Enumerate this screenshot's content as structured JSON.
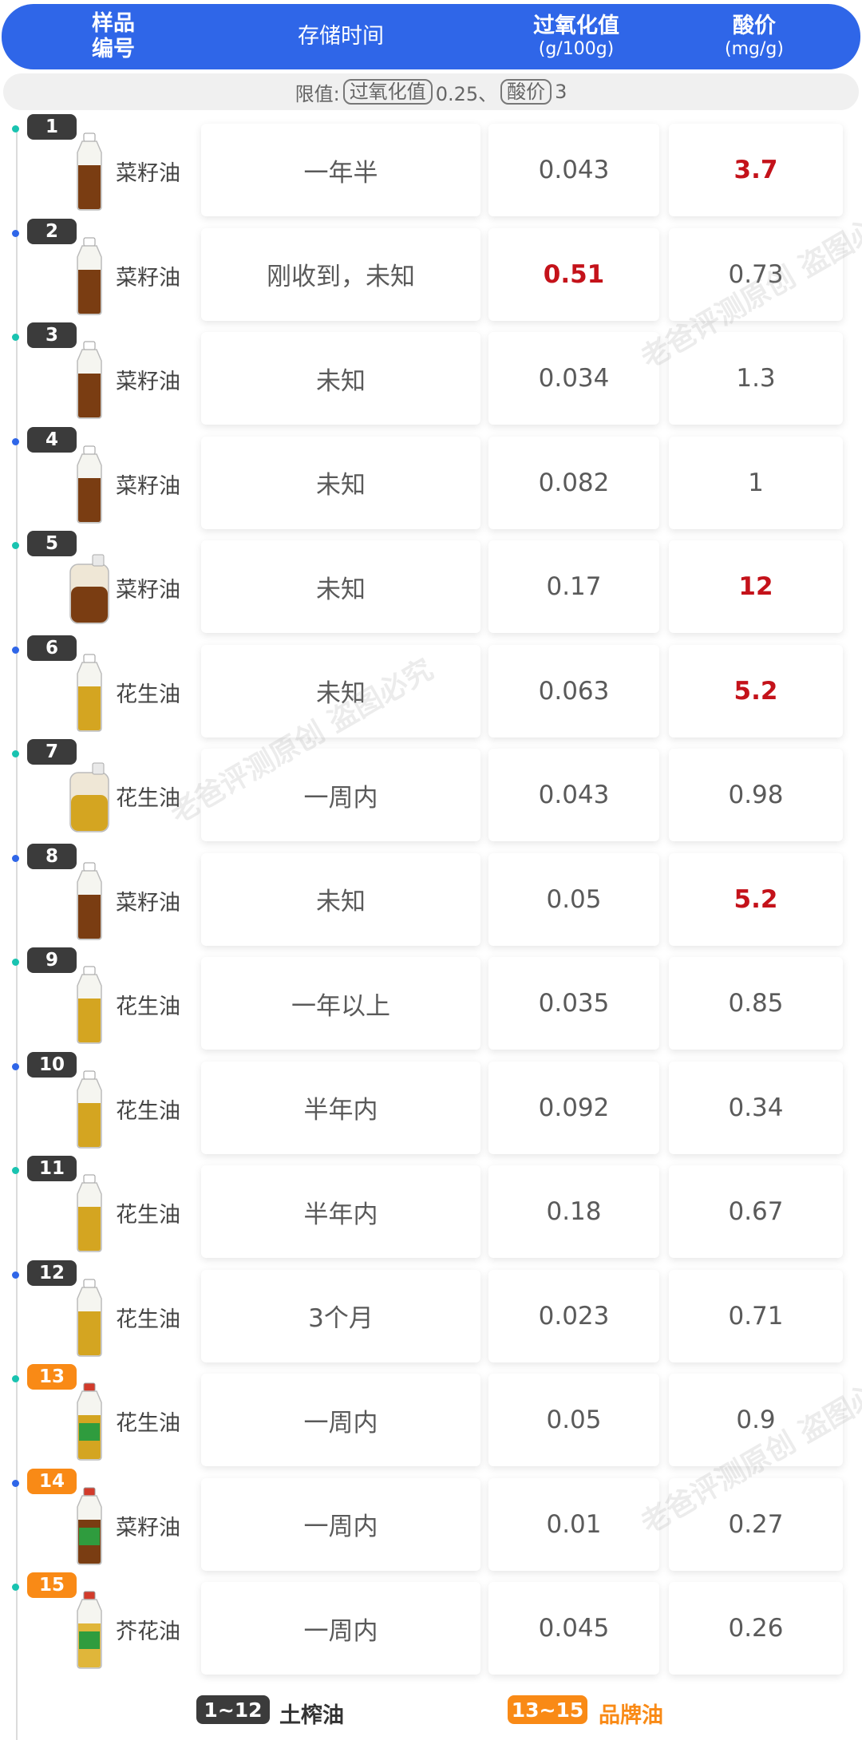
{
  "header": {
    "col_sample_line1": "样品",
    "col_sample_line2": "编号",
    "col_storage": "存储时间",
    "col_peroxide": "过氧化值",
    "col_peroxide_unit": "(g/100g)",
    "col_acid": "酸价",
    "col_acid_unit": "(mg/g)"
  },
  "limits": {
    "prefix": "限值:",
    "peroxide_label": "过氧化值",
    "peroxide_value": "0.25、",
    "acid_label": "酸价",
    "acid_value": "3"
  },
  "rows": [
    {
      "num": "1",
      "name": "菜籽油",
      "storage": "一年半",
      "peroxide": "0.043",
      "acid": "3.7",
      "peroxide_over": false,
      "acid_over": true,
      "brand": false,
      "bottle": "bottle-icon"
    },
    {
      "num": "2",
      "name": "菜籽油",
      "storage": "刚收到，未知",
      "peroxide": "0.51",
      "acid": "0.73",
      "peroxide_over": true,
      "acid_over": false,
      "brand": false,
      "bottle": "bottle-icon"
    },
    {
      "num": "3",
      "name": "菜籽油",
      "storage": "未知",
      "peroxide": "0.034",
      "acid": "1.3",
      "peroxide_over": false,
      "acid_over": false,
      "brand": false,
      "bottle": "bottle-icon"
    },
    {
      "num": "4",
      "name": "菜籽油",
      "storage": "未知",
      "peroxide": "0.082",
      "acid": "1",
      "peroxide_over": false,
      "acid_over": false,
      "brand": false,
      "bottle": "bottle-icon"
    },
    {
      "num": "5",
      "name": "菜籽油",
      "storage": "未知",
      "peroxide": "0.17",
      "acid": "12",
      "peroxide_over": false,
      "acid_over": true,
      "brand": false,
      "bottle": "jug-icon"
    },
    {
      "num": "6",
      "name": "花生油",
      "storage": "未知",
      "peroxide": "0.063",
      "acid": "5.2",
      "peroxide_over": false,
      "acid_over": true,
      "brand": false,
      "bottle": "bottle-icon"
    },
    {
      "num": "7",
      "name": "花生油",
      "storage": "一周内",
      "peroxide": "0.043",
      "acid": "0.98",
      "peroxide_over": false,
      "acid_over": false,
      "brand": false,
      "bottle": "jug-icon"
    },
    {
      "num": "8",
      "name": "菜籽油",
      "storage": "未知",
      "peroxide": "0.05",
      "acid": "5.2",
      "peroxide_over": false,
      "acid_over": true,
      "brand": false,
      "bottle": "bottle-icon"
    },
    {
      "num": "9",
      "name": "花生油",
      "storage": "一年以上",
      "peroxide": "0.035",
      "acid": "0.85",
      "peroxide_over": false,
      "acid_over": false,
      "brand": false,
      "bottle": "bottle-icon"
    },
    {
      "num": "10",
      "name": "花生油",
      "storage": "半年内",
      "peroxide": "0.092",
      "acid": "0.34",
      "peroxide_over": false,
      "acid_over": false,
      "brand": false,
      "bottle": "bottle-icon"
    },
    {
      "num": "11",
      "name": "花生油",
      "storage": "半年内",
      "peroxide": "0.18",
      "acid": "0.67",
      "peroxide_over": false,
      "acid_over": false,
      "brand": false,
      "bottle": "bottle-icon"
    },
    {
      "num": "12",
      "name": "花生油",
      "storage": "3个月",
      "peroxide": "0.023",
      "acid": "0.71",
      "peroxide_over": false,
      "acid_over": false,
      "brand": false,
      "bottle": "bottle-icon"
    },
    {
      "num": "13",
      "name": "花生油",
      "storage": "一周内",
      "peroxide": "0.05",
      "acid": "0.9",
      "peroxide_over": false,
      "acid_over": false,
      "brand": true,
      "bottle": "bottle-icon"
    },
    {
      "num": "14",
      "name": "菜籽油",
      "storage": "一周内",
      "peroxide": "0.01",
      "acid": "0.27",
      "peroxide_over": false,
      "acid_over": false,
      "brand": true,
      "bottle": "bottle-icon"
    },
    {
      "num": "15",
      "name": "芥花油",
      "storage": "一周内",
      "peroxide": "0.045",
      "acid": "0.26",
      "peroxide_over": false,
      "acid_over": false,
      "brand": true,
      "bottle": "bottle-icon"
    }
  ],
  "legend": {
    "home_range": "1~12",
    "home_label": "土榨油",
    "brand_range": "13~15",
    "brand_label": "品牌油"
  },
  "watermark": "老爸评测原创 盗图必究",
  "colors": {
    "header_bg": "#2f66e8",
    "over_limit": "#c4121a",
    "brand_badge": "#f98a16",
    "home_badge": "#3b3b3b",
    "dot_teal": "#19c3b0",
    "dot_blue": "#2f66e8"
  }
}
